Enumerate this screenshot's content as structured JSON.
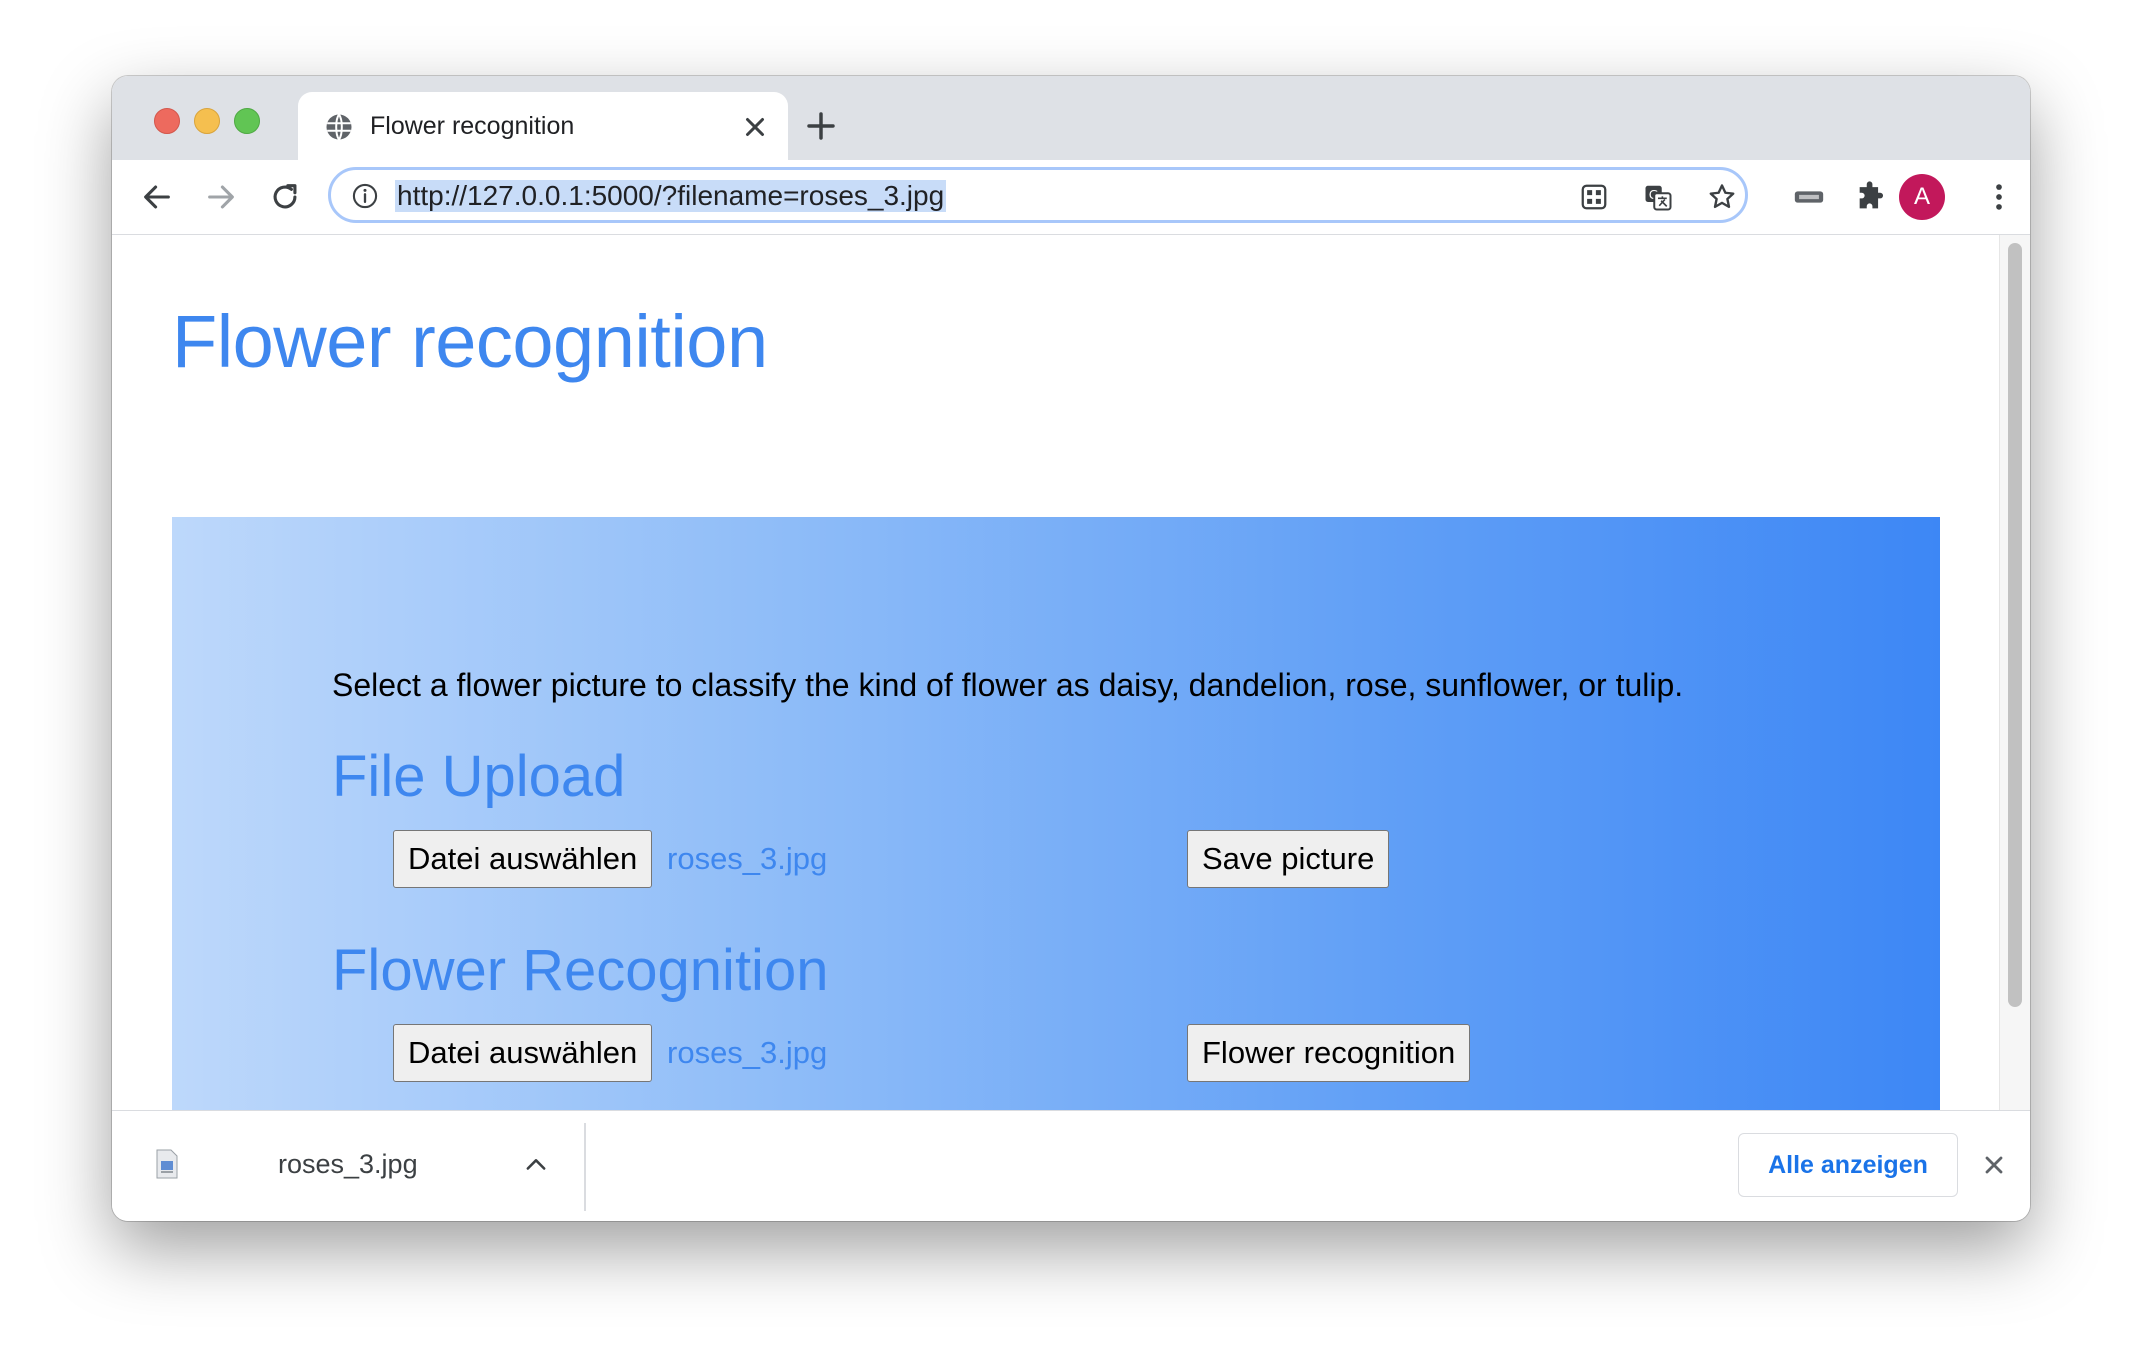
{
  "browser": {
    "tab": {
      "title": "Flower recognition",
      "favicon": "globe-icon"
    },
    "address": {
      "url": "http://127.0.0.1:5000/?filename=roses_3.jpg"
    },
    "profile_initial": "A",
    "accent_color": "#1a73e8",
    "profile_color": "#c2185b",
    "icons": [
      "back-arrow-icon",
      "forward-arrow-icon",
      "reload-icon",
      "info-icon",
      "qr-code-icon",
      "translate-icon",
      "star-icon",
      "media-router-icon",
      "extensions-puzzle-icon",
      "kebab-menu-icon"
    ]
  },
  "page": {
    "title": "Flower recognition",
    "intro": "Select a flower picture to classify the kind of flower as daisy, dandelion, rose, sunflower, or tulip.",
    "upload": {
      "heading": "File Upload",
      "choose_label": "Datei auswählen",
      "file_name": "roses_3.jpg",
      "action_label": "Save picture"
    },
    "recognition": {
      "heading": "Flower Recognition",
      "choose_label": "Datei auswählen",
      "file_name": "roses_3.jpg",
      "action_label": "Flower recognition"
    },
    "colors": {
      "heading": "#3e87ef",
      "panel_start": "#bdd8fb",
      "panel_end": "#3d87f5"
    }
  },
  "downloads": {
    "file_name": "roses_3.jpg",
    "show_all_label": "Alle anzeigen"
  }
}
